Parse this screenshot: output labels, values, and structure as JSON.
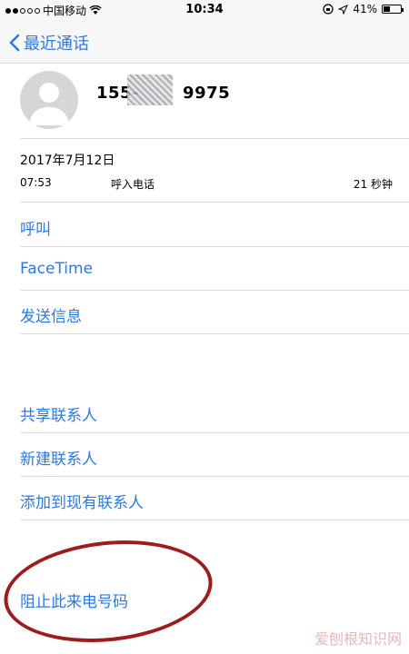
{
  "status": {
    "carrier": "中国移动",
    "time": "10:34",
    "battery": "41%",
    "battery_level": 0.41
  },
  "nav": {
    "back_label": "最近通话"
  },
  "contact": {
    "phone_prefix": "155-",
    "phone_suffix": "9975"
  },
  "call": {
    "date": "2017年7月12日",
    "time": "07:53",
    "type": "呼入电话",
    "duration": "21 秒钟"
  },
  "actions": {
    "call": "呼叫",
    "facetime": "FaceTime",
    "message": "发送信息",
    "share": "共享联系人",
    "new_contact": "新建联系人",
    "add_existing": "添加到现有联系人",
    "block": "阻止此来电号码"
  },
  "watermark": "爱刨根知识网",
  "colors": {
    "accent": "#2a7ae2",
    "annotation": "#9e1c1c"
  }
}
